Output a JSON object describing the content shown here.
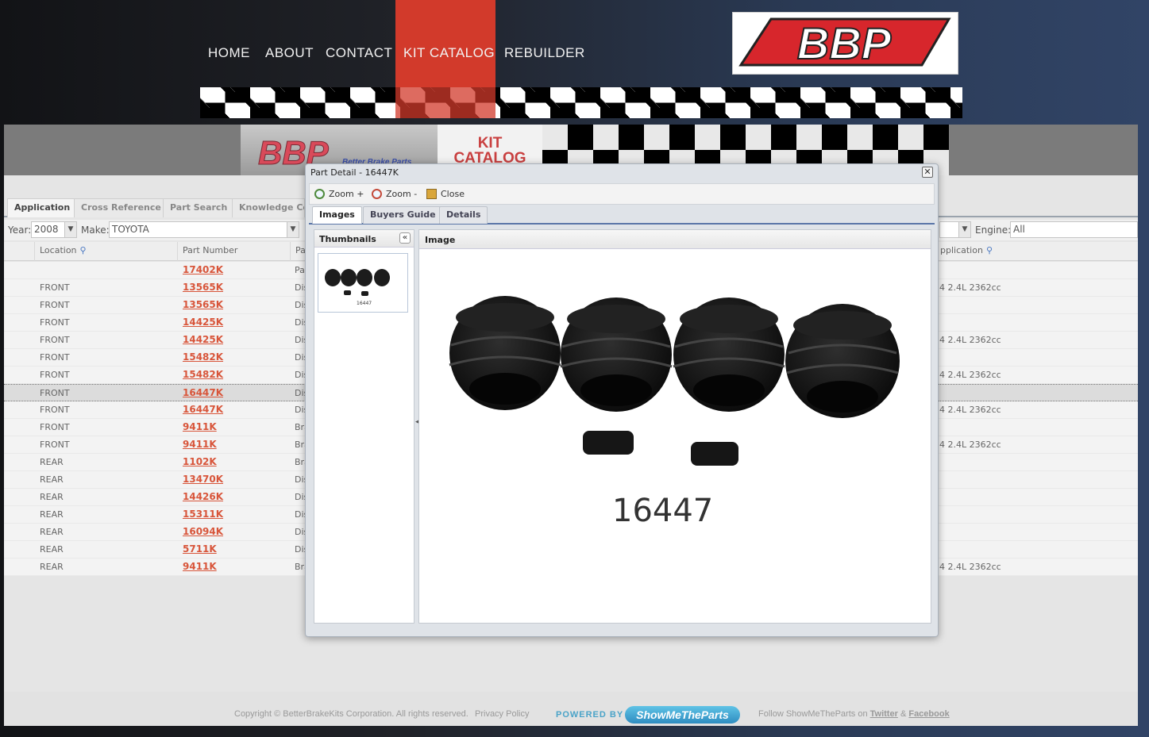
{
  "nav": {
    "items": [
      "HOME",
      "ABOUT",
      "CONTACT",
      "KIT CATALOG",
      "REBUILDER"
    ],
    "active": "KIT CATALOG"
  },
  "logo": {
    "text": "BBP"
  },
  "banner": {
    "logo_text": "BBP",
    "logo_sub": "Better Brake Parts",
    "kit_line1": "KIT",
    "kit_line2": "CATALOG"
  },
  "main_tabs": [
    "Application",
    "Cross Reference",
    "Part Search",
    "Knowledge Cen"
  ],
  "filters": {
    "year_label": "Year:",
    "year": "2008",
    "make_label": "Make:",
    "make": "TOYOTA",
    "engine_label": "Engine:",
    "engine": "All"
  },
  "grid": {
    "headers": {
      "location": "Location",
      "part_number": "Part Number",
      "type": "Pa",
      "application": "pplication"
    },
    "rows": [
      {
        "location": "",
        "part": "17402K",
        "type": "Pa",
        "app": ""
      },
      {
        "location": "FRONT",
        "part": "13565K",
        "type": "Dis",
        "app": "4 2.4L 2362cc"
      },
      {
        "location": "FRONT",
        "part": "13565K",
        "type": "Dis",
        "app": ""
      },
      {
        "location": "FRONT",
        "part": "14425K",
        "type": "Dis",
        "app": ""
      },
      {
        "location": "FRONT",
        "part": "14425K",
        "type": "Dis",
        "app": "4 2.4L 2362cc"
      },
      {
        "location": "FRONT",
        "part": "15482K",
        "type": "Dis",
        "app": ""
      },
      {
        "location": "FRONT",
        "part": "15482K",
        "type": "Dis",
        "app": "4 2.4L 2362cc"
      },
      {
        "location": "FRONT",
        "part": "16447K",
        "type": "Dis",
        "app": ""
      },
      {
        "location": "FRONT",
        "part": "16447K",
        "type": "Dis",
        "app": "4 2.4L 2362cc"
      },
      {
        "location": "FRONT",
        "part": "9411K",
        "type": "Bra",
        "app": ""
      },
      {
        "location": "FRONT",
        "part": "9411K",
        "type": "Bra",
        "app": "4 2.4L 2362cc"
      },
      {
        "location": "REAR",
        "part": "1102K",
        "type": "Bra",
        "app": ""
      },
      {
        "location": "REAR",
        "part": "13470K",
        "type": "Dis",
        "app": ""
      },
      {
        "location": "REAR",
        "part": "14426K",
        "type": "Dis",
        "app": ""
      },
      {
        "location": "REAR",
        "part": "15311K",
        "type": "Dis",
        "app": ""
      },
      {
        "location": "REAR",
        "part": "16094K",
        "type": "Dis",
        "app": ""
      },
      {
        "location": "REAR",
        "part": "5711K",
        "type": "Dis",
        "app": ""
      },
      {
        "location": "REAR",
        "part": "9411K",
        "type": "Bra",
        "app": "4 2.4L 2362cc"
      }
    ]
  },
  "modal": {
    "title": "Part Detail - 16447K",
    "close_glyph": "✕",
    "toolbar": {
      "zoom_in": "Zoom +",
      "zoom_out": "Zoom -",
      "close": "Close"
    },
    "tabs": [
      "Images",
      "Buyers Guide",
      "Details"
    ],
    "thumbnails_title": "Thumbnails",
    "collapse_glyph": "«",
    "image_title": "Image",
    "photo_label": "16447",
    "thumb_label": "16447"
  },
  "footer": {
    "copyright": "Copyright © BetterBrakeKits Corporation. All rights reserved.",
    "privacy": "Privacy Policy",
    "powered": "POWERED BY",
    "smtp": "ShowMeTheParts",
    "follow": "Follow ShowMeTheParts on",
    "twitter": "Twitter",
    "amp": "&",
    "facebook": "Facebook"
  },
  "colors": {
    "accent_red": "#d23a2b",
    "link": "#d8553a",
    "tab_border": "#5a76a8"
  }
}
